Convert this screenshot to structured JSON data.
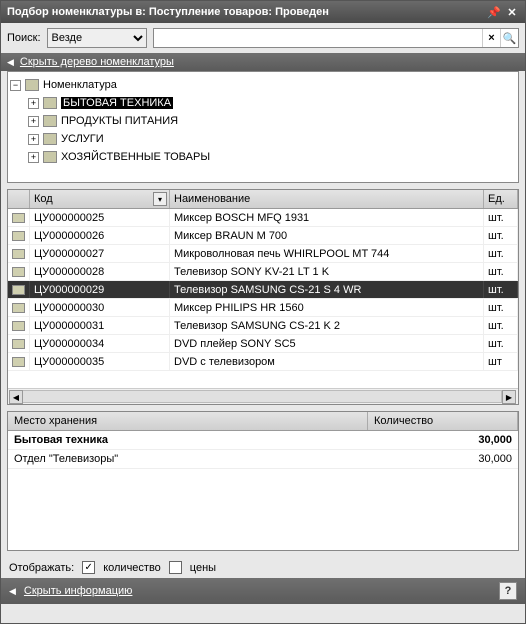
{
  "window": {
    "title": "Подбор номенклатуры в: Поступление товаров: Проведен"
  },
  "search": {
    "label": "Поиск:",
    "scope": "Везде",
    "value": "",
    "clear_glyph": "×",
    "search_glyph": "🔍"
  },
  "tree_strip": {
    "arrow": "◀",
    "label": "Скрыть дерево номенклатуры"
  },
  "tree": {
    "root": {
      "label": "Номенклатура",
      "exp": "−"
    },
    "children": [
      {
        "label": "БЫТОВАЯ ТЕХНИКА",
        "exp": "+",
        "selected": true
      },
      {
        "label": "ПРОДУКТЫ ПИТАНИЯ",
        "exp": "+",
        "selected": false
      },
      {
        "label": "УСЛУГИ",
        "exp": "+",
        "selected": false
      },
      {
        "label": "ХОЗЯЙСТВЕННЫЕ ТОВАРЫ",
        "exp": "+",
        "selected": false
      }
    ]
  },
  "grid": {
    "columns": {
      "code": "Код",
      "name": "Наименование",
      "unit": "Ед."
    },
    "rows": [
      {
        "code": "ЦУ000000025",
        "name": "Миксер BOSCH MFQ 1931",
        "unit": "шт.",
        "sel": false
      },
      {
        "code": "ЦУ000000026",
        "name": "Миксер BRAUN M 700",
        "unit": "шт.",
        "sel": false
      },
      {
        "code": "ЦУ000000027",
        "name": "Микроволновая печь WHIRLPOOL MT 744",
        "unit": "шт.",
        "sel": false
      },
      {
        "code": "ЦУ000000028",
        "name": "Телевизор SONY KV-21 LT 1 K",
        "unit": "шт.",
        "sel": false
      },
      {
        "code": "ЦУ000000029",
        "name": "Телевизор SAMSUNG CS-21 S 4 WR",
        "unit": "шт.",
        "sel": true
      },
      {
        "code": "ЦУ000000030",
        "name": "Миксер PHILIPS HR 1560",
        "unit": "шт.",
        "sel": false
      },
      {
        "code": "ЦУ000000031",
        "name": "Телевизор SAMSUNG CS-21 K 2",
        "unit": "шт.",
        "sel": false
      },
      {
        "code": "ЦУ000000034",
        "name": "DVD плейер SONY SC5",
        "unit": "шт.",
        "sel": false
      },
      {
        "code": "ЦУ000000035",
        "name": "DVD с телевизором",
        "unit": "шт",
        "sel": false
      }
    ]
  },
  "storage": {
    "columns": {
      "place": "Место хранения",
      "qty": "Количество"
    },
    "rows": [
      {
        "place": "Бытовая техника",
        "qty": "30,000",
        "bold": true
      },
      {
        "place": "Отдел \"Телевизоры\"",
        "qty": "30,000",
        "bold": false
      }
    ]
  },
  "show": {
    "label": "Отображать:",
    "qty_label": "количество",
    "qty_checked": true,
    "price_label": "цены",
    "price_checked": false
  },
  "bottom_strip": {
    "arrow": "◀",
    "label": "Скрыть информацию",
    "help": "?"
  }
}
